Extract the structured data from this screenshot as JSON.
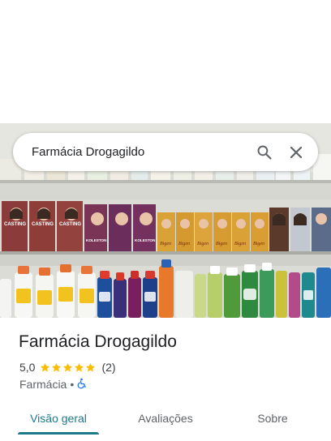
{
  "search": {
    "query": "Farmácia Drogagildo"
  },
  "place": {
    "name": "Farmácia Drogagildo",
    "rating": "5,0",
    "stars": 5,
    "review_count": "(2)",
    "category": "Farmácia",
    "separator": "•"
  },
  "photo": {
    "box_labels": [
      "CASTING",
      "CASTING",
      "CASTING",
      "KOLESTON",
      "KOLESTON",
      "Bigen",
      "Bigen",
      "Bigen",
      "Bigen",
      "Bigen",
      "Bigen"
    ]
  },
  "tabs": [
    {
      "label": "Visão geral",
      "active": true
    },
    {
      "label": "Avaliações",
      "active": false
    },
    {
      "label": "Sobre",
      "active": false
    }
  ],
  "colors": {
    "accent": "#1a7a8c",
    "star": "#fbbc04",
    "accessibility": "#1a73e8"
  },
  "icons": {
    "search": "search-icon",
    "close": "close-icon",
    "accessibility": "wheelchair-icon",
    "star": "star-icon"
  }
}
